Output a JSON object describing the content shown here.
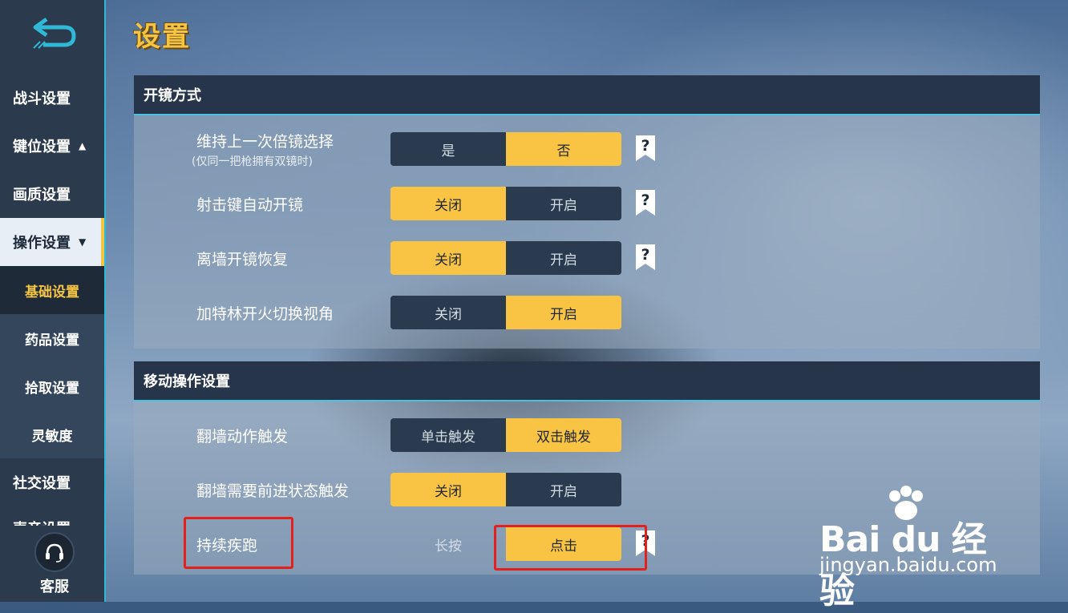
{
  "title": "设置",
  "sidebar": {
    "items": [
      {
        "label": "战斗设置",
        "arrow": ""
      },
      {
        "label": "键位设置",
        "arrow": "▲"
      },
      {
        "label": "画质设置",
        "arrow": ""
      },
      {
        "label": "操作设置",
        "arrow": "▼"
      }
    ],
    "sub_items": [
      "基础设置",
      "药品设置",
      "拾取设置",
      "灵敏度"
    ],
    "more_items": [
      {
        "label": "社交设置"
      },
      {
        "label": "声音设置"
      }
    ],
    "customer_service": "客服",
    "selected_sub": "基础设置"
  },
  "sections": [
    {
      "title": "开镜方式",
      "rows": [
        {
          "label": "维持上一次倍镜选择",
          "sub": "(仅同一把枪拥有双镜时)",
          "options": [
            "是",
            "否"
          ],
          "selected": 1,
          "help": true
        },
        {
          "label": "射击键自动开镜",
          "sub": "",
          "options": [
            "关闭",
            "开启"
          ],
          "selected": 0,
          "help": true
        },
        {
          "label": "离墙开镜恢复",
          "sub": "",
          "options": [
            "关闭",
            "开启"
          ],
          "selected": 0,
          "help": true
        },
        {
          "label": "加特林开火切换视角",
          "sub": "",
          "options": [
            "关闭",
            "开启"
          ],
          "selected": 1,
          "help": false
        }
      ]
    },
    {
      "title": "移动操作设置",
      "rows": [
        {
          "label": "翻墙动作触发",
          "sub": "",
          "options": [
            "单击触发",
            "双击触发"
          ],
          "selected": 1,
          "help": false
        },
        {
          "label": "翻墙需要前进状态触发",
          "sub": "",
          "options": [
            "关闭",
            "开启"
          ],
          "selected": 0,
          "help": false
        },
        {
          "label": "持续疾跑",
          "sub": "",
          "options": [
            "长按",
            "点击"
          ],
          "selected": 1,
          "help": true
        }
      ]
    }
  ],
  "help_symbol": "?",
  "watermark": {
    "brand": "Bai du 经验",
    "url": "jingyan.baidu.com"
  },
  "colors": {
    "accent": "#f9c443",
    "sidebar": "#2b3a4d",
    "highlight": "#e3201b",
    "cyan": "#2fb9d6"
  }
}
